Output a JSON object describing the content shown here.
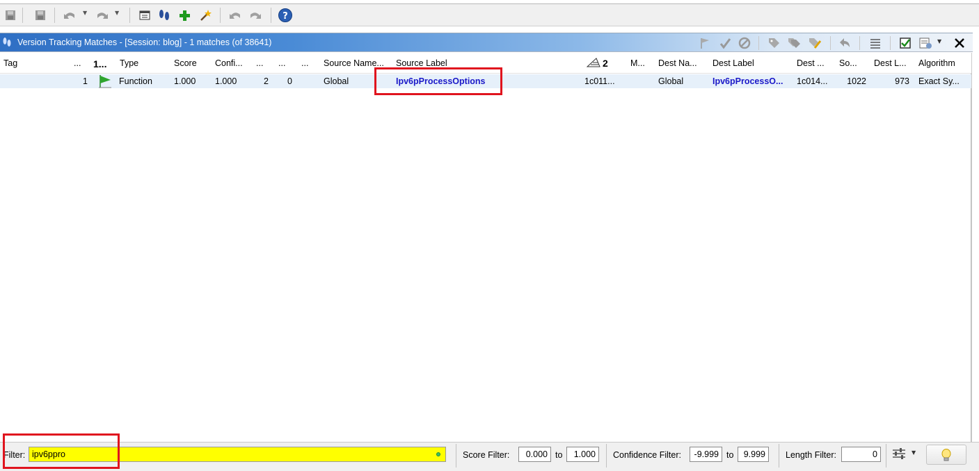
{
  "toolbar": {
    "icons": [
      "save-icon",
      "save-as-icon",
      "undo-icon",
      "redo-icon",
      "window-icon",
      "footprints-icon",
      "add-icon",
      "wand-icon",
      "undo-gray-icon",
      "redo-gray-icon",
      "help-icon"
    ]
  },
  "panel": {
    "title": "Version Tracking Matches - [Session: blog] - 1 matches (of 38641)",
    "title_buttons": [
      "flag-icon",
      "check-icon",
      "reject-icon",
      "tag-icon",
      "tags-icon",
      "edit-tag-icon",
      "revert-icon",
      "list-icon",
      "checkbox-icon",
      "config-icon",
      "close-icon"
    ]
  },
  "table": {
    "headers": {
      "tag": "Tag",
      "col2": "...",
      "col3": "1...",
      "type": "Type",
      "score": "Score",
      "confidence": "Confi...",
      "col7": "...",
      "col8": "...",
      "col9": "...",
      "source_namespace": "Source Name...",
      "source_label": "Source Label",
      "source_address": "2",
      "col13": "M...",
      "dest_namespace": "Dest Na...",
      "dest_label": "Dest Label",
      "dest_address": "Dest ...",
      "source_length": "So...",
      "dest_length": "Dest L...",
      "algorithm": "Algorithm"
    },
    "rows": [
      {
        "index": "1",
        "type": "Function",
        "score": "1.000",
        "confidence": "1.000",
        "c7": "2",
        "c8": "0",
        "source_namespace": "Global",
        "source_label": "Ipv6pProcessOptions",
        "source_address": "1c011...",
        "dest_namespace": "Global",
        "dest_label": "Ipv6pProcessO...",
        "dest_address": "1c014...",
        "source_length": "1022",
        "dest_length": "973",
        "algorithm": "Exact Sy..."
      }
    ]
  },
  "filters": {
    "filter_label": "Filter:",
    "filter_value": "ipv6ppro",
    "score_label": "Score Filter:",
    "score_min": "0.000",
    "to1": "to",
    "score_max": "1.000",
    "confidence_label": "Confidence Filter:",
    "confidence_min": "-9.999",
    "to2": "to",
    "confidence_max": "9.999",
    "length_label": "Length Filter:",
    "length_value": "0"
  },
  "colors": {
    "highlight": "#e0141e",
    "filter_bg": "#ffff00",
    "link": "#1a18c8",
    "row_selected": "#e6f0fa"
  }
}
